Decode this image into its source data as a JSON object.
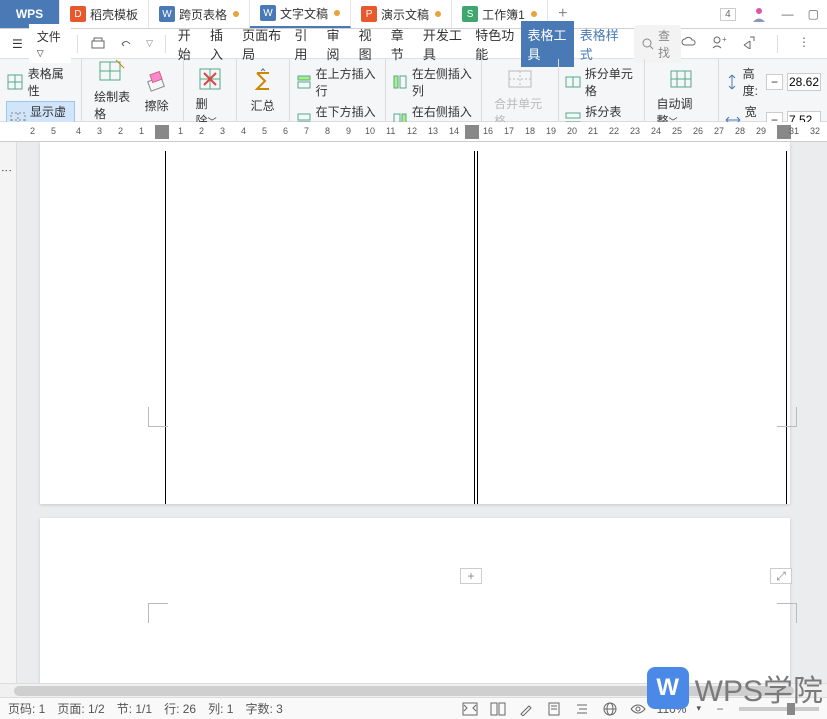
{
  "titlebar": {
    "wps": "WPS",
    "tabs": [
      {
        "icon_bg": "#e8582d",
        "icon": "D",
        "label": "稻壳模板"
      },
      {
        "icon_bg": "#4a7ab6",
        "icon": "W",
        "label": "跨页表格",
        "dot": true
      },
      {
        "icon_bg": "#4a7ab6",
        "icon": "W",
        "label": "文字文稿",
        "dot": true
      },
      {
        "icon_bg": "#e8582d",
        "icon": "P",
        "label": "演示文稿",
        "dot": true
      },
      {
        "icon_bg": "#3fa66e",
        "icon": "S",
        "label": "工作簿1",
        "dot": true
      }
    ],
    "badge": "4"
  },
  "menubar": {
    "file": "文件",
    "tabs": [
      "开始",
      "插入",
      "页面布局",
      "引用",
      "审阅",
      "视图",
      "章节",
      "开发工具",
      "特色功能",
      "表格工具",
      "表格样式"
    ],
    "active_index": 9,
    "search_placeholder": "查找"
  },
  "ribbon": {
    "g1a": "表格属性",
    "g1b": "显示虚框",
    "g2": "绘制表格",
    "g3": "擦除",
    "g4": "删除",
    "g5": "汇总",
    "g6a": "在上方插入行",
    "g6b": "在下方插入行",
    "g7a": "在左侧插入列",
    "g7b": "在右侧插入列",
    "g8": "合并单元格",
    "g9a": "拆分单元格",
    "g9b": "拆分表格",
    "g10": "自动调整",
    "g11a": "高度:",
    "g11b": "宽度:",
    "h_val": "28.62",
    "w_val": "7.52"
  },
  "ruler_nums": [
    2,
    5,
    4,
    3,
    2,
    1,
    1,
    2,
    3,
    4,
    5,
    6,
    7,
    8,
    9,
    10,
    11,
    12,
    13,
    14,
    15,
    16,
    17,
    18,
    19,
    20,
    21,
    22,
    23,
    24,
    25,
    26,
    27,
    28,
    29,
    30,
    31,
    32
  ],
  "statusbar": {
    "page_code": "页码: 1",
    "page": "页面: 1/2",
    "section": "节: 1/1",
    "line": "行: 26",
    "col": "列: 1",
    "chars": "字数: 3",
    "zoom": "110%"
  },
  "watermark": "WPS学院"
}
